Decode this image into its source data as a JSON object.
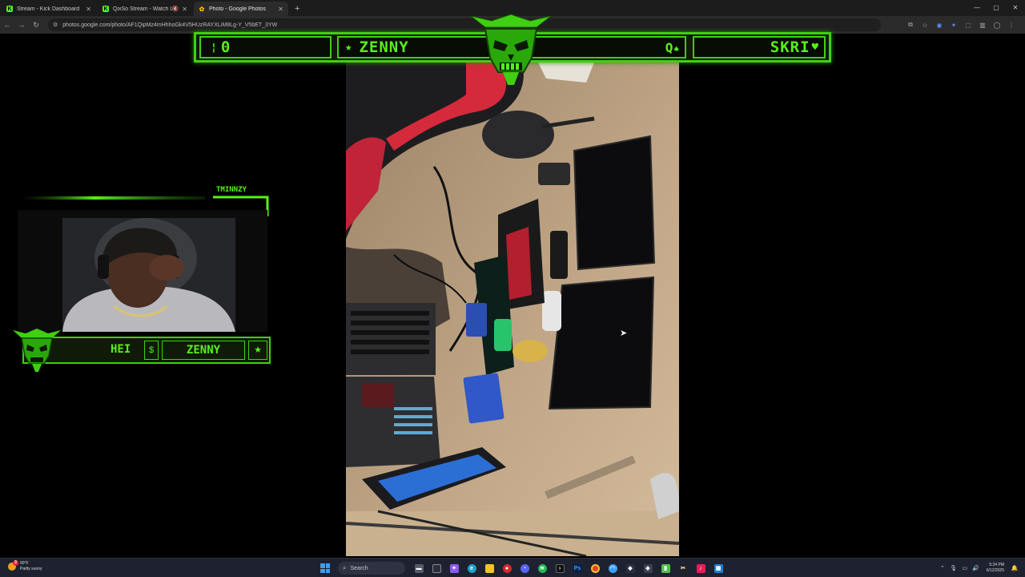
{
  "browser": {
    "tabs": [
      {
        "title": "Stream - Kick Dashboard",
        "favicon": "kick-icon",
        "active": false
      },
      {
        "title": "QixSo Stream - Watch Live",
        "favicon": "kick-icon",
        "active": false
      },
      {
        "title": "Photo - Google Photos",
        "favicon": "google-photos-icon",
        "active": true
      }
    ],
    "url": "photos.google.com/photo/AF1QipMz4mHhhoGk4V5HUzRAYXLiM8Lg-Y_V5bET_3YW"
  },
  "overlay": {
    "top_left": "0",
    "top_center": "ZENNY",
    "top_center_glyph": "Q",
    "top_right": "SKRI",
    "cam_name": "TMINNZY",
    "cam_bar_left": "HEI",
    "cam_bar_dollar": "$",
    "cam_bar_center": "ZENNY",
    "cam_bar_star": "★",
    "accent_color": "#3fcf13"
  },
  "taskbar": {
    "weather_temp": "90°F",
    "weather_desc": "Partly sunny",
    "weather_badge": "3",
    "search_placeholder": "Search",
    "time": "5:34 PM",
    "date": "6/12/2025"
  }
}
